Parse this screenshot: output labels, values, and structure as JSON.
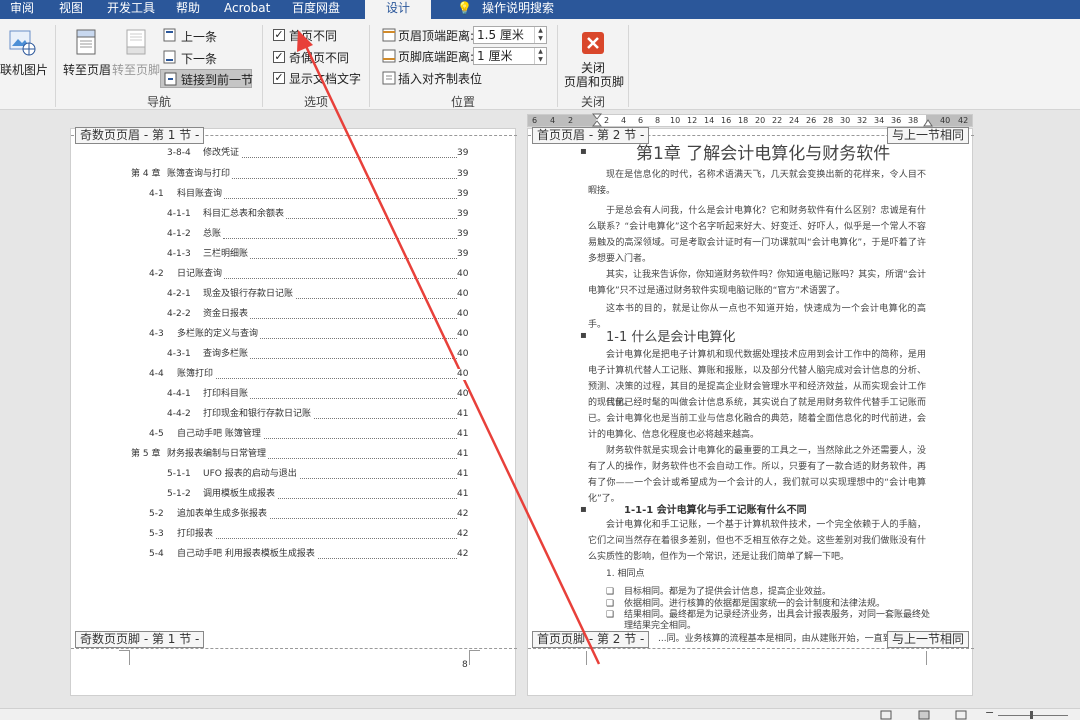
{
  "tabs": [
    "审阅",
    "视图",
    "开发工具",
    "帮助",
    "Acrobat",
    "百度网盘",
    "设计",
    "操作说明搜索"
  ],
  "ribbon": {
    "online_picture": "联机图片",
    "goto_header": "转至页眉",
    "goto_footer": "转至页脚",
    "prev": "上一条",
    "next": "下一条",
    "link_prev": "链接到前一节",
    "nav_label": "导航",
    "first_page_diff": "首页不同",
    "odd_even_diff": "奇偶页不同",
    "show_doc_text": "显示文档文字",
    "options_label": "选项",
    "header_top_label": "页眉顶端距离:",
    "header_top_value": "1.5 厘米",
    "footer_bottom_label": "页脚底端距离:",
    "footer_bottom_value": "1 厘米",
    "insert_align_tab": "插入对齐制表位",
    "position_label": "位置",
    "close_label_1": "关闭",
    "close_label_2": "页眉和页脚",
    "close_group_label": "关闭"
  },
  "ruler_ticks": [
    "6",
    "4",
    "2",
    "2",
    "4",
    "6",
    "8",
    "10",
    "12",
    "14",
    "16",
    "18",
    "20",
    "22",
    "24",
    "26",
    "28",
    "30",
    "32",
    "34",
    "36",
    "38",
    "40",
    "42"
  ],
  "left_page": {
    "header_tag": "奇数页页眉 - 第 1 节 -",
    "footer_tag": "奇数页页脚 - 第 1 节 -",
    "footer_page_num": "8",
    "toc": [
      {
        "num": "3-8-4",
        "title": "修改凭证",
        "page": "39"
      },
      {
        "num": "第 4 章",
        "title": "账簿查询与打印",
        "page": "39"
      },
      {
        "num": "4-1",
        "title": "科目账查询",
        "page": "39"
      },
      {
        "num": "4-1-1",
        "title": "科目汇总表和余额表",
        "page": "39"
      },
      {
        "num": "4-1-2",
        "title": "总账",
        "page": "39"
      },
      {
        "num": "4-1-3",
        "title": "三栏明细账",
        "page": "39"
      },
      {
        "num": "4-2",
        "title": "日记账查询",
        "page": "40"
      },
      {
        "num": "4-2-1",
        "title": "现金及银行存款日记账",
        "page": "40"
      },
      {
        "num": "4-2-2",
        "title": "资金日报表",
        "page": "40"
      },
      {
        "num": "4-3",
        "title": "多栏账的定义与查询",
        "page": "40"
      },
      {
        "num": "4-3-1",
        "title": "查询多栏账",
        "page": "40"
      },
      {
        "num": "4-4",
        "title": "账簿打印",
        "page": "40"
      },
      {
        "num": "4-4-1",
        "title": "打印科目账",
        "page": "40"
      },
      {
        "num": "4-4-2",
        "title": "打印现金和银行存款日记账",
        "page": "41"
      },
      {
        "num": "4-5",
        "title": "自己动手吧    账簿管理",
        "page": "41"
      },
      {
        "num": "第 5 章",
        "title": "财务报表编制与日常管理",
        "page": "41"
      },
      {
        "num": "5-1-1",
        "title": "UFO 报表的启动与退出",
        "page": "41"
      },
      {
        "num": "5-1-2",
        "title": "调用模板生成报表",
        "page": "41"
      },
      {
        "num": "5-2",
        "title": "追加表单生成多张报表",
        "page": "42"
      },
      {
        "num": "5-3",
        "title": "打印报表",
        "page": "42"
      },
      {
        "num": "5-4",
        "title": "自己动手吧    利用报表模板生成报表",
        "page": "42"
      }
    ]
  },
  "right_page": {
    "header_tag": "首页页眉 - 第 2 节 -",
    "header_same": "与上一节相同",
    "footer_tag": "首页页脚 - 第 2 节 -",
    "footer_same": "与上一节相同",
    "chapter_title": "第1章    了解会计电算化与财务软件",
    "p1": "现在是信息化的时代，名称术语满天飞，几天就会变换出新的花样来，令人目不暇接。",
    "p2": "于是总会有人问我，什么是会计电算化？它和财务软件有什么区别？忠诚是有什么联系？“会计电算化”这个名字听起来好大、好变迁、好吓人，似乎是一个常人不容易触及的高深领域。可是考取会计证时有一门功课就叫“会计电算化”，于是吓着了许多想要入门者。",
    "p3": "其实，让我来告诉你，你知道财务软件吗？你知道电脑记账吗？其实，所谓“会计电算化”只不过是通过财务软件实现电脑记账的“官方”术语罢了。",
    "p4": "这本书的目的，就是让你从一点也不知道开始，快速成为一个会计电算化的高手。",
    "h2": "1-1  什么是会计电算化",
    "p5": "会计电算化是把电子计算机和现代数据处理技术应用到会计工作中的简称，是用电子计算机代替人工记账、算账和报账，以及部分代替人脑完成对会计信息的分析、预测、决策的过程，其目的是提高企业财会管理水平和经济效益，从而实现会计工作的现代化。",
    "p6": "目前已经时髦的叫做会计信息系统，其实说白了就是用财务软件代替手工记账而已。会计电算化也是当前工业与信息化融合的典范，随着全面信息化的时代前进，会计的电算化、信息化程度也必将越来越高。",
    "p7": "财务软件就是实现会计电算化的最重要的工具之一，当然除此之外还需要人，没有了人的操作，财务软件也不会自动工作。所以，只要有了一款合适的财务软件，再有了你——一个会计或希望成为一个会计的人，我们就可以实现理想中的“会计电算化”了。",
    "h3": "1-1-1  会计电算化与手工记账有什么不同",
    "p8": "会计电算化和手工记账，一个基于计算机软件技术，一个完全依赖于人的手脑，它们之间当然存在着很多差别，但也不乏相互依存之处。这些差别对我们做账没有什么实质性的影响，但作为一个常识，还是让我们简单了解一下吧。",
    "list_title": "1.  相同点",
    "b1": "目标相同。都是为了提供会计信息，提高企业效益。",
    "b2": "依据相同。进行核算的依据都是国家统一的会计制度和法律法规。",
    "b3": "结果相同。最终都是为记录经济业务，出具会计报表服务，对同一套账最终处",
    "b3b": "理结果完全相同。",
    "b4": "...同。业务核算的流程基本是相同，由从建账开始，一直到出"
  }
}
